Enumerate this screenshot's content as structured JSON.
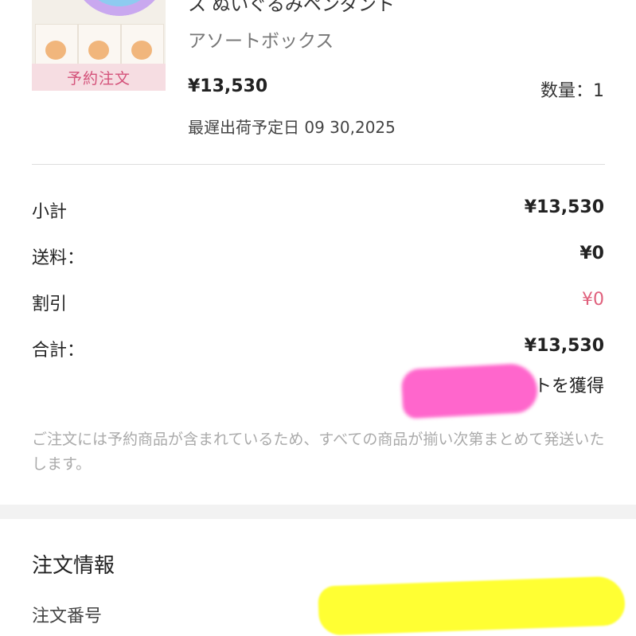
{
  "product": {
    "badge": "予約注文",
    "name": "ス ぬいぐるみペンダント",
    "variant": "アソートボックス",
    "price": "¥13,530",
    "quantity": "数量：1",
    "ship_date": "最遅出荷予定日 09 30,2025"
  },
  "summary": {
    "subtotal_label": "小計",
    "subtotal_value": "¥13,530",
    "shipping_label": "送料：",
    "shipping_value": "¥0",
    "discount_label": "割引",
    "discount_value": "¥0",
    "total_label": "合計：",
    "total_value": "¥13,530",
    "points_text": "トを獲得"
  },
  "note": "ご注文には予約商品が含まれているため、すべての商品が揃い次第まとめて発送いたします。",
  "order_info": {
    "title": "注文情報",
    "order_number_label": "注文番号"
  },
  "colors": {
    "discount": "#e0607c",
    "badge_text": "#d4527a",
    "badge_bg": "#f6dde2",
    "redaction_pink": "#ff66cc",
    "redaction_yellow": "#ffff33"
  }
}
